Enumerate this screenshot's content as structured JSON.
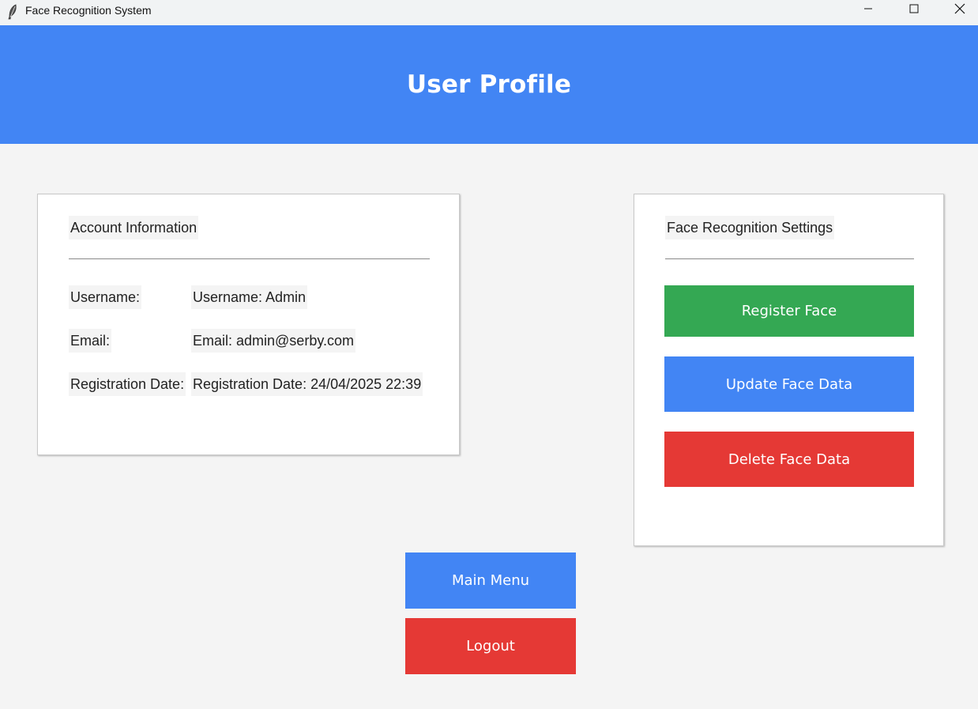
{
  "window": {
    "title": "Face Recognition System",
    "icon": "feather-icon",
    "controls": [
      "minimize-icon",
      "maximize-icon",
      "close-icon"
    ]
  },
  "header": {
    "title": "User Profile",
    "background": "#4285f4"
  },
  "account": {
    "title": "Account Information",
    "rows": [
      {
        "label": "Username:",
        "value": "Username: Admin"
      },
      {
        "label": "Email:",
        "value": "Email: admin@serby.com"
      },
      {
        "label": "Registration Date:",
        "value": "Registration Date: 24/04/2025 22:39"
      }
    ]
  },
  "face_settings": {
    "title": "Face Recognition Settings",
    "register_label": "Register Face",
    "update_label": "Update Face Data",
    "delete_label": "Delete Face Data"
  },
  "nav": {
    "main_menu_label": "Main Menu",
    "logout_label": "Logout"
  },
  "colors": {
    "green": "#34a853",
    "blue": "#4285f4",
    "red": "#e53935",
    "background": "#f4f4f4"
  }
}
